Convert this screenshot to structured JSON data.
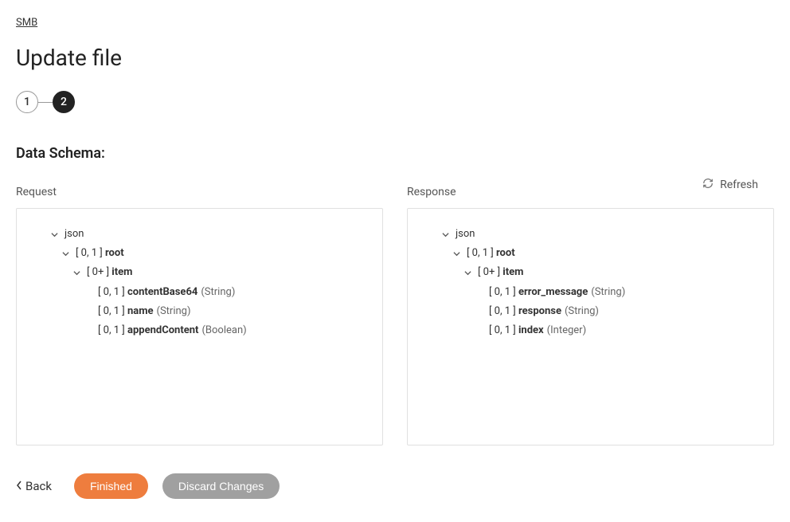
{
  "breadcrumb": "SMB",
  "page_title": "Update file",
  "stepper": {
    "steps": [
      "1",
      "2"
    ],
    "active_index": 1
  },
  "section_title": "Data Schema:",
  "refresh_label": "Refresh",
  "panels": {
    "request": {
      "label": "Request",
      "tree": {
        "root": "json",
        "root_card": "[ 0, 1 ]",
        "root_name": "root",
        "item_card": "[ 0+ ]",
        "item_name": "item",
        "fields": [
          {
            "card": "[ 0, 1 ]",
            "name": "contentBase64",
            "type": "(String)"
          },
          {
            "card": "[ 0, 1 ]",
            "name": "name",
            "type": "(String)"
          },
          {
            "card": "[ 0, 1 ]",
            "name": "appendContent",
            "type": "(Boolean)"
          }
        ]
      }
    },
    "response": {
      "label": "Response",
      "tree": {
        "root": "json",
        "root_card": "[ 0, 1 ]",
        "root_name": "root",
        "item_card": "[ 0+ ]",
        "item_name": "item",
        "fields": [
          {
            "card": "[ 0, 1 ]",
            "name": "error_message",
            "type": "(String)"
          },
          {
            "card": "[ 0, 1 ]",
            "name": "response",
            "type": "(String)"
          },
          {
            "card": "[ 0, 1 ]",
            "name": "index",
            "type": "(Integer)"
          }
        ]
      }
    }
  },
  "footer": {
    "back": "Back",
    "finished": "Finished",
    "discard": "Discard Changes"
  },
  "colors": {
    "primary": "#ee7d3e",
    "step_active": "#222222",
    "secondary": "#a0a0a0"
  }
}
